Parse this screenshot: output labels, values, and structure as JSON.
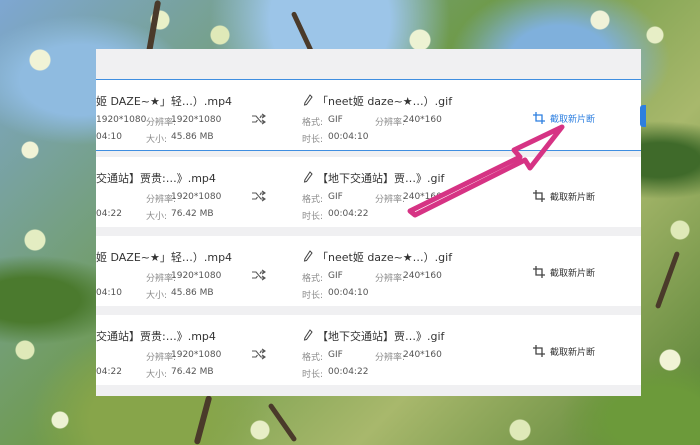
{
  "rows": [
    {
      "source_name": "姬 DAZE~★」轻…）.mp4",
      "resolution_label": "分辨率:",
      "resolution": "1920*1080",
      "source_duration": "04:10",
      "size_label": "大小:",
      "size": "45.86 MB",
      "output_name": "「neet姬 daze~★…）.gif",
      "format_label": "格式:",
      "format": "GIF",
      "output_resolution_label": "分辨率:",
      "output_resolution": "240*160",
      "duration_label": "时长:",
      "output_duration": "00:04:10",
      "crop_label": "截取新片断"
    },
    {
      "source_name": "交通站】贾贵:…》.mp4",
      "resolution_label": "分辨率:",
      "resolution": "1920*1080",
      "source_duration": "04:22",
      "size_label": "大小:",
      "size": "76.42 MB",
      "output_name": "【地下交通站】贾…》.gif",
      "format_label": "格式:",
      "format": "GIF",
      "output_resolution_label": "分辨率:",
      "output_resolution": "240*160",
      "duration_label": "时长:",
      "output_duration": "00:04:22",
      "crop_label": "截取新片断"
    },
    {
      "source_name": "姬 DAZE~★」轻…）.mp4",
      "resolution_label": "分辨率:",
      "resolution": "1920*1080",
      "source_duration": "04:10",
      "size_label": "大小:",
      "size": "45.86 MB",
      "output_name": "「neet姬 daze~★…）.gif",
      "format_label": "格式:",
      "format": "GIF",
      "output_resolution_label": "分辨率:",
      "output_resolution": "240*160",
      "duration_label": "时长:",
      "output_duration": "00:04:10",
      "crop_label": "截取新片断"
    },
    {
      "source_name": "交通站】贾贵:…》.mp4",
      "resolution_label": "分辨率:",
      "resolution": "1920*1080",
      "source_duration": "04:22",
      "size_label": "大小:",
      "size": "76.42 MB",
      "output_name": "【地下交通站】贾…》.gif",
      "format_label": "格式:",
      "format": "GIF",
      "output_resolution_label": "分辨率:",
      "output_resolution": "240*160",
      "duration_label": "时长:",
      "output_duration": "00:04:22",
      "crop_label": "截取新片断"
    }
  ],
  "colors": {
    "accent": "#2d7fe0",
    "arrow": "#d63384",
    "icon": "#555555"
  },
  "icons": {
    "edit": "pencil-icon",
    "convert": "shuffle-icon",
    "crop": "crop-icon"
  }
}
